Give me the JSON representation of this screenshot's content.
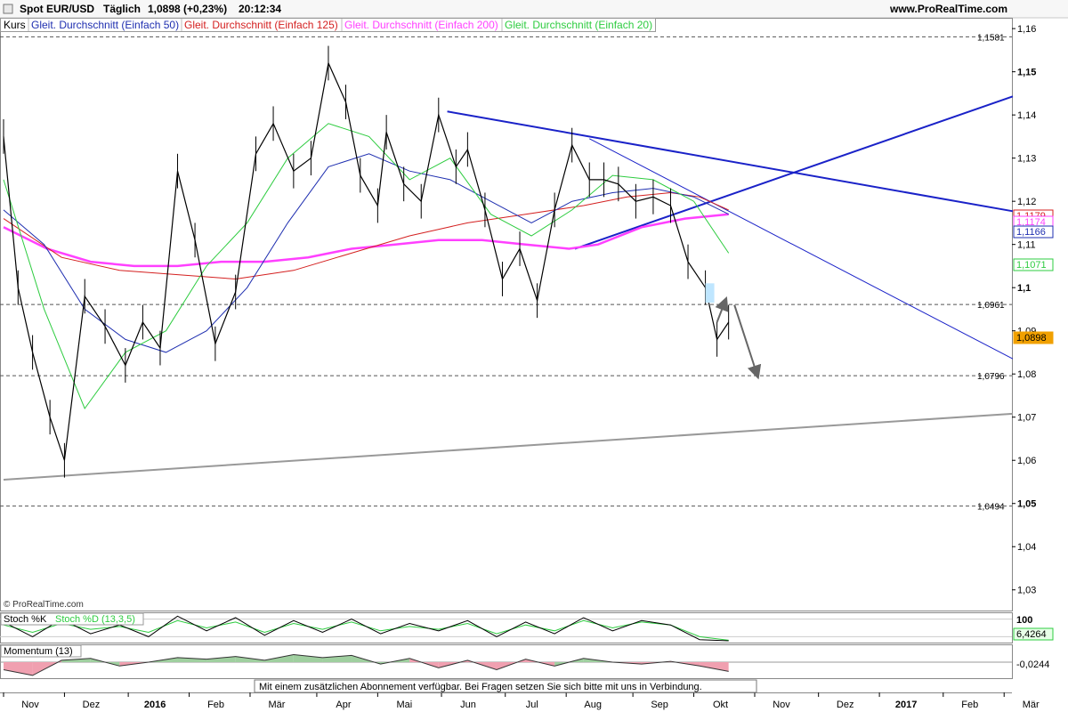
{
  "header": {
    "instrument": "Spot EUR/USD",
    "period": "Täglich",
    "price_change": "1,0898 (+0,23%)",
    "time": "20:12:34",
    "brand": "www.ProRealTime.com"
  },
  "legend": [
    {
      "label": "Kurs",
      "color": "#000000"
    },
    {
      "label": "Gleit. Durchschnitt (Einfach 50)",
      "color": "#1f2fb0"
    },
    {
      "label": "Gleit. Durchschnitt (Einfach 125)",
      "color": "#d42020"
    },
    {
      "label": "Gleit. Durchschnitt (Einfach 200)",
      "color": "#ff40ff"
    },
    {
      "label": "Gleit. Durchschnitt (Einfach 20)",
      "color": "#2ecc40"
    }
  ],
  "copyright": "© ProRealTime.com",
  "stoch": {
    "label_k": "Stoch %K",
    "label_d": "Stoch %D (13,3,5)",
    "top_label": "100",
    "value_label": "6,4264"
  },
  "momentum": {
    "label": "Momentum (13)",
    "value_label": "-0,0244"
  },
  "notice": "Mit einem zusätzlichen Abonnement verfügbar. Bei Fragen setzen Sie sich bitte mit uns in Verbindung.",
  "colors": {
    "sma20": "#2ecc40",
    "sma50": "#1f2fb0",
    "sma125": "#d42020",
    "sma200": "#ff40ff",
    "trend": "#1a22c8",
    "support": "#999999"
  },
  "chart_data": {
    "type": "line",
    "ylim": [
      1.025,
      1.1625
    ],
    "y_ticks": [
      "1,03",
      "1,04",
      "1,05",
      "1,06",
      "1,07",
      "1,08",
      "1,09",
      "1,1",
      "1,11",
      "1,12",
      "1,13",
      "1,14",
      "1,15",
      "1,16"
    ],
    "y_tick_values": [
      1.03,
      1.04,
      1.05,
      1.06,
      1.07,
      1.08,
      1.09,
      1.1,
      1.11,
      1.12,
      1.13,
      1.14,
      1.15,
      1.16
    ],
    "y_bold_ticks": [
      "1,05",
      "1,1",
      "1,15"
    ],
    "x_months": [
      "Nov",
      "Dez",
      "2016",
      "Feb",
      "Mär",
      "Apr",
      "Mai",
      "Jun",
      "Jul",
      "Aug",
      "Sep",
      "Okt",
      "Nov",
      "Dez",
      "2017",
      "Feb",
      "Mär"
    ],
    "x_month_index": [
      0,
      21,
      43,
      64,
      85,
      108,
      129,
      151,
      173,
      194,
      217,
      238,
      259,
      281,
      302,
      324,
      345
    ],
    "levels": [
      {
        "label": "1,1581",
        "value": 1.1581
      },
      {
        "label": "1,0961",
        "value": 1.0961
      },
      {
        "label": "1,0796",
        "value": 1.0796
      },
      {
        "label": "1,0494",
        "value": 1.0494
      }
    ],
    "ma_labels": [
      {
        "label": "1,1179",
        "value": 1.1179,
        "color": "#d42020"
      },
      {
        "label": "1,1174",
        "value": 1.1174,
        "color": "#ff40ff"
      },
      {
        "label": "1,1166",
        "value": 1.1166,
        "color": "#1f2fb0"
      },
      {
        "label": "1,1071",
        "value": 1.1071,
        "color": "#2ecc40"
      },
      {
        "label": "1,0898",
        "value": 1.0898,
        "color": "#f0a000"
      }
    ],
    "close_series": {
      "name": "Kurs",
      "x": [
        0,
        5,
        10,
        16,
        21,
        28,
        35,
        42,
        48,
        54,
        60,
        66,
        73,
        80,
        87,
        93,
        100,
        106,
        112,
        118,
        123,
        129,
        132,
        138,
        144,
        150,
        156,
        160,
        166,
        172,
        178,
        184,
        190,
        196,
        202,
        207,
        212,
        218,
        224,
        230,
        236,
        242,
        246,
        250
      ],
      "y": [
        1.135,
        1.1,
        1.085,
        1.07,
        1.06,
        1.098,
        1.091,
        1.082,
        1.092,
        1.086,
        1.127,
        1.111,
        1.087,
        1.099,
        1.131,
        1.138,
        1.127,
        1.13,
        1.152,
        1.143,
        1.126,
        1.119,
        1.136,
        1.124,
        1.12,
        1.14,
        1.128,
        1.132,
        1.118,
        1.102,
        1.109,
        1.097,
        1.118,
        1.133,
        1.125,
        1.125,
        1.124,
        1.12,
        1.121,
        1.119,
        1.106,
        1.1,
        1.088,
        1.092
      ]
    },
    "sma20": {
      "x": [
        0,
        14,
        28,
        42,
        56,
        70,
        84,
        98,
        112,
        126,
        140,
        154,
        168,
        182,
        196,
        210,
        224,
        238,
        250
      ],
      "y": [
        1.125,
        1.095,
        1.072,
        1.085,
        1.09,
        1.105,
        1.115,
        1.13,
        1.138,
        1.135,
        1.125,
        1.13,
        1.117,
        1.112,
        1.118,
        1.126,
        1.125,
        1.12,
        1.108
      ]
    },
    "sma50": {
      "x": [
        0,
        14,
        28,
        42,
        56,
        70,
        84,
        98,
        112,
        126,
        140,
        154,
        168,
        182,
        196,
        210,
        224,
        238,
        250
      ],
      "y": [
        1.118,
        1.11,
        1.095,
        1.088,
        1.085,
        1.09,
        1.1,
        1.115,
        1.128,
        1.131,
        1.127,
        1.125,
        1.12,
        1.115,
        1.12,
        1.122,
        1.123,
        1.121,
        1.117
      ]
    },
    "sma125": {
      "x": [
        0,
        20,
        40,
        60,
        80,
        100,
        120,
        140,
        160,
        180,
        200,
        215,
        230,
        240,
        250
      ],
      "y": [
        1.116,
        1.107,
        1.104,
        1.103,
        1.102,
        1.104,
        1.108,
        1.112,
        1.115,
        1.117,
        1.119,
        1.121,
        1.122,
        1.121,
        1.118
      ]
    },
    "sma200": {
      "x": [
        0,
        15,
        30,
        45,
        60,
        75,
        90,
        105,
        120,
        135,
        150,
        165,
        180,
        195,
        205,
        220,
        235,
        250
      ],
      "y": [
        1.114,
        1.109,
        1.106,
        1.105,
        1.105,
        1.106,
        1.106,
        1.107,
        1.109,
        1.11,
        1.111,
        1.111,
        1.11,
        1.109,
        1.11,
        1.114,
        1.116,
        1.117
      ]
    },
    "trendlines": [
      {
        "name": "upper-trend",
        "x": [
          153,
          348
        ],
        "y": [
          1.1408,
          1.1177
        ],
        "color": "#1a22c8",
        "width": 2
      },
      {
        "name": "rising-trend",
        "x": [
          197,
          348
        ],
        "y": [
          1.109,
          1.1443
        ],
        "color": "#1a22c8",
        "width": 2
      },
      {
        "name": "falling-trend-thin",
        "x": [
          202,
          348
        ],
        "y": [
          1.1345,
          1.0835
        ],
        "color": "#1a22c8",
        "width": 1
      },
      {
        "name": "support-line",
        "x": [
          0,
          348
        ],
        "y": [
          1.0555,
          1.0708
        ],
        "color": "#999999",
        "width": 2
      }
    ],
    "arrows": [
      {
        "name": "up-arrow",
        "from": [
          246,
          1.092
        ],
        "to": [
          249,
          1.0972
        ]
      },
      {
        "name": "down-arrow",
        "from": [
          252,
          1.096
        ],
        "to": [
          260,
          1.0795
        ]
      }
    ],
    "stoch_k": {
      "x": [
        0,
        10,
        20,
        30,
        40,
        50,
        60,
        70,
        80,
        90,
        100,
        110,
        120,
        130,
        140,
        150,
        160,
        170,
        180,
        190,
        200,
        210,
        220,
        230,
        240,
        250
      ],
      "y": [
        70,
        20,
        80,
        30,
        60,
        20,
        90,
        40,
        85,
        25,
        75,
        35,
        80,
        30,
        65,
        40,
        75,
        20,
        70,
        30,
        85,
        40,
        75,
        60,
        10,
        6
      ]
    },
    "stoch_d": {
      "x": [
        0,
        10,
        20,
        30,
        40,
        50,
        60,
        70,
        80,
        90,
        100,
        110,
        120,
        130,
        140,
        150,
        160,
        170,
        180,
        190,
        200,
        210,
        220,
        230,
        240,
        250
      ],
      "y": [
        60,
        35,
        65,
        45,
        55,
        35,
        75,
        50,
        70,
        35,
        65,
        45,
        70,
        40,
        55,
        45,
        65,
        30,
        60,
        40,
        75,
        50,
        70,
        60,
        20,
        8
      ]
    },
    "momentum": {
      "x": [
        0,
        10,
        20,
        30,
        40,
        50,
        60,
        70,
        80,
        90,
        100,
        110,
        120,
        130,
        140,
        150,
        160,
        170,
        180,
        190,
        200,
        210,
        220,
        230,
        240,
        250
      ],
      "y": [
        -0.02,
        -0.035,
        0.005,
        0.01,
        -0.01,
        0.0,
        0.012,
        0.008,
        0.015,
        0.005,
        0.02,
        0.012,
        0.018,
        -0.005,
        0.01,
        -0.015,
        0.005,
        -0.02,
        0.008,
        -0.01,
        0.01,
        0.0,
        -0.005,
        0.002,
        -0.01,
        -0.0244
      ]
    }
  }
}
